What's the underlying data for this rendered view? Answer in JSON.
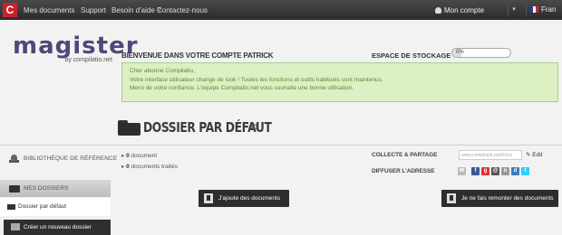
{
  "topbar": {
    "logo_letter": "C",
    "links": [
      "Mes documents",
      "Support",
      "Besoin d'aide ?",
      "Contactez-nous"
    ],
    "account_label": "Mon compte",
    "language_label": "Fran"
  },
  "brand": {
    "name": "magister",
    "sub": "by compilatio.net"
  },
  "welcome": {
    "title": "BIENVENUE DANS VOTRE COMPTE PATRICK",
    "storage_label": "ESPACE DE STOCKAGE",
    "storage_value": "0%",
    "storage_fraction": 0.15
  },
  "notice": {
    "lines": [
      "Cher abonné Compilatio,",
      "Votre interface utilisateur change de look ! Toutes les fonctions et outils habituels sont maintenus.",
      "Merci de votre confiance. L'équipe Compilatio.net vous souhaite une bonne utilisation."
    ]
  },
  "folder": {
    "title": "DOSSIER PAR DÉFAUT"
  },
  "sidebar": {
    "library": "BIBLIOTHÈQUE DE RÉFÉRENCE",
    "my_folders": "MES DOSSIERS",
    "default_folder": "Dossier par défaut",
    "new_folder": "Créer un nouveau dossier"
  },
  "stats": [
    {
      "count": "0",
      "label": "document"
    },
    {
      "count": "0",
      "label": "documents traités"
    }
  ],
  "share": {
    "collect_label": "COLLECTE & PARTAGE",
    "address_placeholder": "www.compilatio.net/fr/xxx",
    "edit_label": "Edit",
    "diffuse_label": "DIFFUSER L'ADRESSE",
    "social_icons": [
      "mail-icon",
      "facebook-icon",
      "google-icon",
      "email-icon",
      "netvibes-icon",
      "delicious-icon",
      "twitter-icon"
    ]
  },
  "buttons": {
    "add_documents": "J'ajoute des documents",
    "show_all": "Je ne fais remonter des documents"
  }
}
